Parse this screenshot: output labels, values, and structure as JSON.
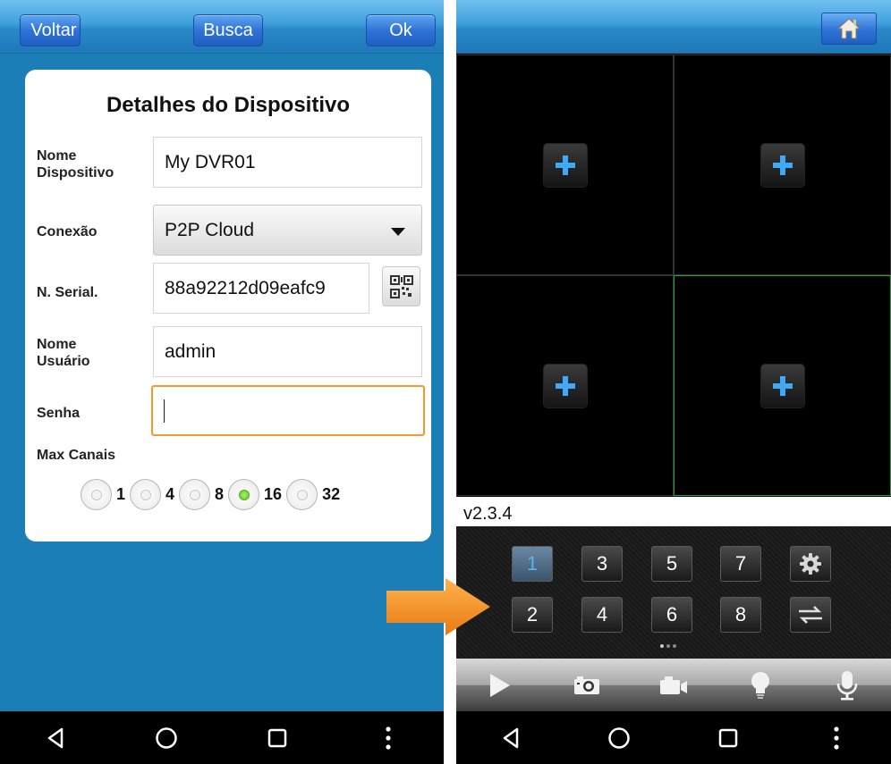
{
  "left": {
    "top_bar": {
      "back": "Voltar",
      "search": "Busca",
      "ok": "Ok"
    },
    "title": "Detalhes do Dispositivo",
    "device_name": {
      "label_line1": "Nome",
      "label_line2": "Dispositivo",
      "value": "My DVR01"
    },
    "connection": {
      "label": "Conexão",
      "value": "P2P Cloud"
    },
    "serial": {
      "label": "N. Serial.",
      "value": "88a92212d09eafc9"
    },
    "username": {
      "label_line1": "Nome",
      "label_line2": "Usuário",
      "value": "admin"
    },
    "password": {
      "label": "Senha",
      "value": ""
    },
    "max_channels": {
      "label": "Max Canais",
      "options": [
        "1",
        "4",
        "8",
        "16",
        "32"
      ],
      "selected": "16"
    }
  },
  "right": {
    "version": "v2.3.4",
    "channels": [
      "1",
      "3",
      "5",
      "7",
      "2",
      "4",
      "6",
      "8"
    ],
    "active_channel": "1"
  },
  "icons": {
    "nav": [
      "back-triangle-icon",
      "home-circle-icon",
      "recents-square-icon",
      "overflow-dots-icon"
    ],
    "toolbar": [
      "play-icon",
      "camera-icon",
      "video-camera-icon",
      "light-bulb-icon",
      "microphone-icon"
    ]
  },
  "colors": {
    "accent_orange": "#f39a2e",
    "selected_green": "#5ec323",
    "plus_blue": "#3fa9f5"
  }
}
